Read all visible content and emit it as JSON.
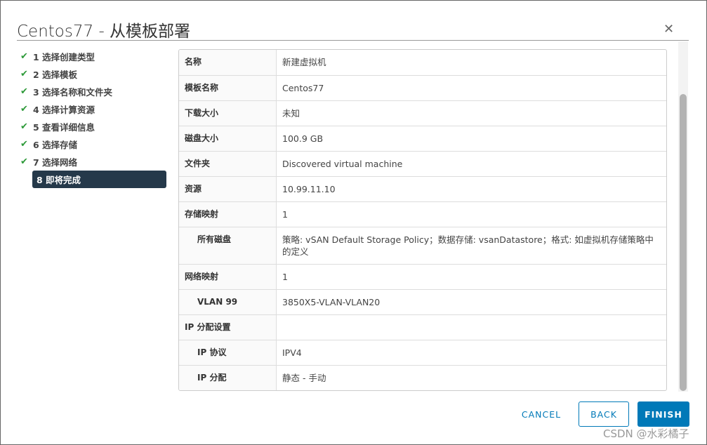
{
  "dialog": {
    "title": "Centos77 - 从模板部署",
    "close_icon": "close-icon"
  },
  "steps": [
    {
      "label": "1 选择创建类型",
      "done": true
    },
    {
      "label": "2 选择模板",
      "done": true
    },
    {
      "label": "3 选择名称和文件夹",
      "done": true
    },
    {
      "label": "4 选择计算资源",
      "done": true
    },
    {
      "label": "5 查看详细信息",
      "done": true
    },
    {
      "label": "6 选择存储",
      "done": true
    },
    {
      "label": "7 选择网络",
      "done": true
    },
    {
      "label": "8 即将完成",
      "done": false,
      "active": true
    }
  ],
  "check_mark": "✔",
  "summary": [
    {
      "label": "名称",
      "value": "新建虚拟机"
    },
    {
      "label": "模板名称",
      "value": "Centos77"
    },
    {
      "label": "下载大小",
      "value": "未知"
    },
    {
      "label": "磁盘大小",
      "value": "100.9 GB"
    },
    {
      "label": "文件夹",
      "value": "Discovered virtual machine"
    },
    {
      "label": "资源",
      "value": "10.99.11.10"
    },
    {
      "label": "存储映射",
      "value": "1"
    },
    {
      "label": "所有磁盘",
      "value": "策略: vSAN Default Storage Policy；数据存储: vsanDatastore；格式: 如虚拟机存储策略中的定义",
      "sub": true
    },
    {
      "label": "网络映射",
      "value": "1"
    },
    {
      "label": "VLAN 99",
      "value": "3850X5-VLAN-VLAN20",
      "sub": true
    },
    {
      "label": "IP 分配设置",
      "value": ""
    },
    {
      "label": "IP 协议",
      "value": "IPV4",
      "sub": true
    },
    {
      "label": "IP 分配",
      "value": "静态 - 手动",
      "sub": true
    }
  ],
  "buttons": {
    "cancel": "CANCEL",
    "back": "BACK",
    "finish": "FINISH"
  },
  "watermark": "CSDN @水彩橘子",
  "colors": {
    "primary": "#0079b8",
    "active_step": "#25394a",
    "check": "#2e9a3a"
  }
}
